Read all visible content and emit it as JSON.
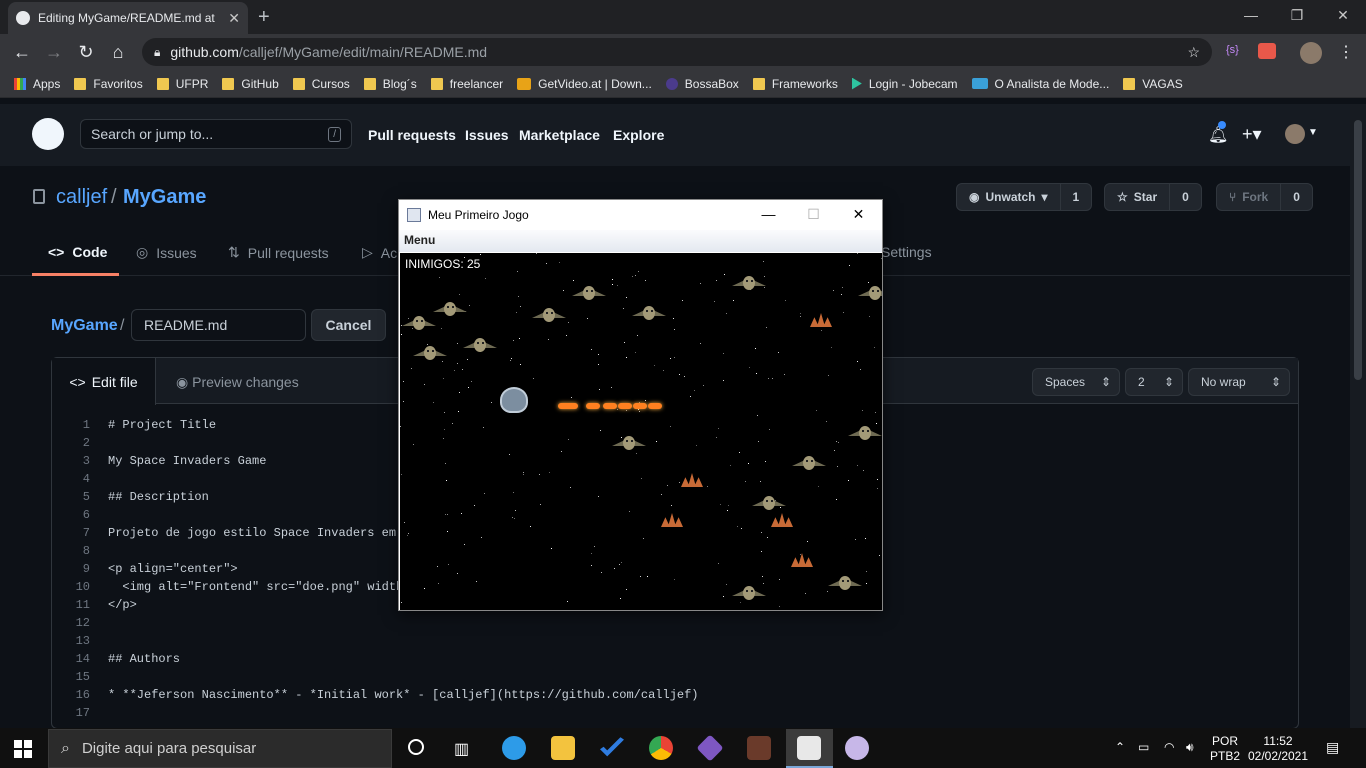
{
  "browser": {
    "tab_title": "Editing MyGame/README.md at",
    "url_host": "github.com",
    "url_path": "/calljef/MyGame/edit/main/README.md",
    "bookmarks": [
      "Apps",
      "Favoritos",
      "UFPR",
      "GitHub",
      "Cursos",
      "Blog´s",
      "freelancer",
      "GetVideo.at | Down...",
      "BossaBox",
      "Frameworks",
      "Login - Jobecam",
      "O Analista de Mode...",
      "VAGAS"
    ]
  },
  "github": {
    "search_placeholder": "Search or jump to...",
    "search_key": "/",
    "nav": [
      "Pull requests",
      "Issues",
      "Marketplace",
      "Explore"
    ],
    "owner": "calljef",
    "repo": "MyGame",
    "unwatch_label": "Unwatch",
    "unwatch_count": "1",
    "star_label": "Star",
    "star_count": "0",
    "fork_label": "Fork",
    "fork_count": "0",
    "tabs": {
      "code": "Code",
      "issues": "Issues",
      "pulls": "Pull requests",
      "actions": "Ac",
      "settings": "Settings"
    },
    "crumb_repo": "MyGame",
    "filename": "README.md",
    "cancel_label": "Cancel",
    "edit_tab": "Edit file",
    "preview_tab": "Preview changes",
    "indent_mode": "Spaces",
    "indent_size": "2",
    "wrap_mode": "No wrap",
    "code_lines": [
      "# Project Title",
      "",
      "My Space Invaders Game",
      "",
      "## Description",
      "",
      "Projeto de jogo estilo Space Invaders em Jav",
      "",
      "<p align=\"center\">",
      "  <img alt=\"Frontend\" src=\"doe.png\" width=\"1",
      "</p>",
      "",
      "",
      "## Authors",
      "",
      "* **Jeferson Nascimento** - *Initial work* - [calljef](https://github.com/calljef)",
      ""
    ]
  },
  "game_window": {
    "title": "Meu Primeiro Jogo",
    "menu": "Menu",
    "hud": "INIMIGOS: 25"
  },
  "taskbar": {
    "search_placeholder": "Digite aqui para pesquisar",
    "lang_top": "POR",
    "lang_bottom": "PTB2",
    "time": "11:52",
    "date": "02/02/2021"
  }
}
